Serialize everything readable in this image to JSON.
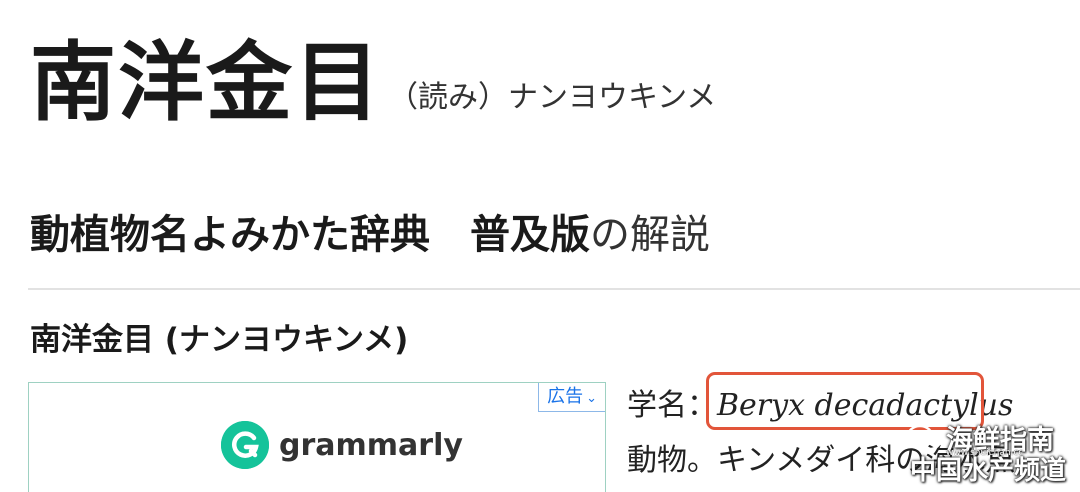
{
  "entry": {
    "headword": "南洋金目",
    "reading": "（読み）ナンヨウキンメ"
  },
  "dictionary": {
    "title_bold": "動植物名よみかた辞典　普及版",
    "title_suffix": "の解説"
  },
  "entry_title": "南洋金目 (ナンヨウキンメ)",
  "ad": {
    "badge_label": "広告",
    "brand_letter": "G",
    "brand_name": "grammarly",
    "brand_color": "#15c39a"
  },
  "body": {
    "sci_prefix": "学名：",
    "sci_name": "Beryx decadactylus",
    "description": "動物。キンメダイ科の海水魚"
  },
  "watermark": {
    "line1": "海鲜指南",
    "line2": "中国水产频道",
    "small": "www.shuichan.cc"
  },
  "colors": {
    "highlight": "#e2553a",
    "ad_border": "#9ed1c2",
    "link_blue": "#1a73e8"
  }
}
